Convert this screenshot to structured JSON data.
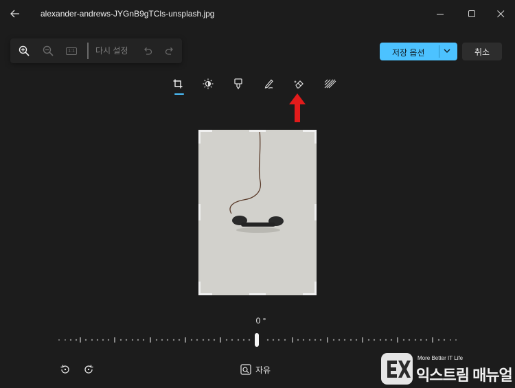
{
  "window": {
    "title": "alexander-andrews-JYGnB9gTCls-unsplash.jpg",
    "controls": [
      "minimize-icon",
      "maximize-icon",
      "close-icon"
    ]
  },
  "toolbar": {
    "zoom_in_icon": "zoom-in-icon",
    "zoom_out_icon": "zoom-out-icon",
    "actual_size_label": "1:1",
    "reset_label": "다시 설정",
    "undo_icon": "undo-icon",
    "redo_icon": "redo-icon"
  },
  "actions": {
    "save_label": "저장 옵션",
    "cancel_label": "취소"
  },
  "tools": [
    {
      "name": "crop-icon",
      "selected": true
    },
    {
      "name": "adjustment-icon",
      "selected": false
    },
    {
      "name": "filter-icon",
      "selected": false
    },
    {
      "name": "markup-icon",
      "selected": false
    },
    {
      "name": "retouch-icon",
      "selected": false
    },
    {
      "name": "background-blur-icon",
      "selected": false
    }
  ],
  "straighten": {
    "angle_label": "0 °"
  },
  "bottom": {
    "aspect_label": "자유",
    "rotate_left_icon": "rotate-left-icon",
    "rotate_right_icon": "rotate-right-icon"
  },
  "watermark": {
    "tagline": "More Better IT Life",
    "name": "익스트림 매뉴얼"
  },
  "colors": {
    "background": "#1c1c1c",
    "accent": "#4cc2ff",
    "arrow": "#e21b1b",
    "photo": "#d2d1cc"
  }
}
